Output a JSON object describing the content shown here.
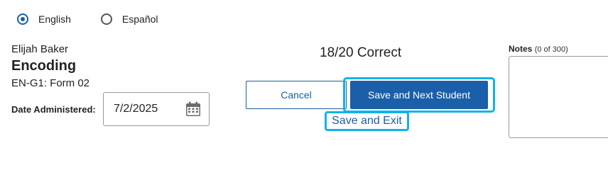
{
  "language": {
    "options": [
      {
        "label": "English",
        "selected": true
      },
      {
        "label": "Español",
        "selected": false
      }
    ]
  },
  "student": {
    "name": "Elijah Baker",
    "assessment": "Encoding",
    "form": "EN-G1: Form 02"
  },
  "date": {
    "label": "Date Administered:",
    "value": "7/2/2025",
    "icon": "calendar-icon"
  },
  "score": {
    "text": "18/20 Correct"
  },
  "actions": {
    "cancel_label": "Cancel",
    "save_next_label": "Save and Next Student",
    "save_exit_label": "Save and Exit"
  },
  "notes": {
    "label": "Notes",
    "count": "(0 of 300)",
    "value": ""
  },
  "colors": {
    "primary": "#1a5fa8",
    "focus_ring": "#12b3e6"
  }
}
